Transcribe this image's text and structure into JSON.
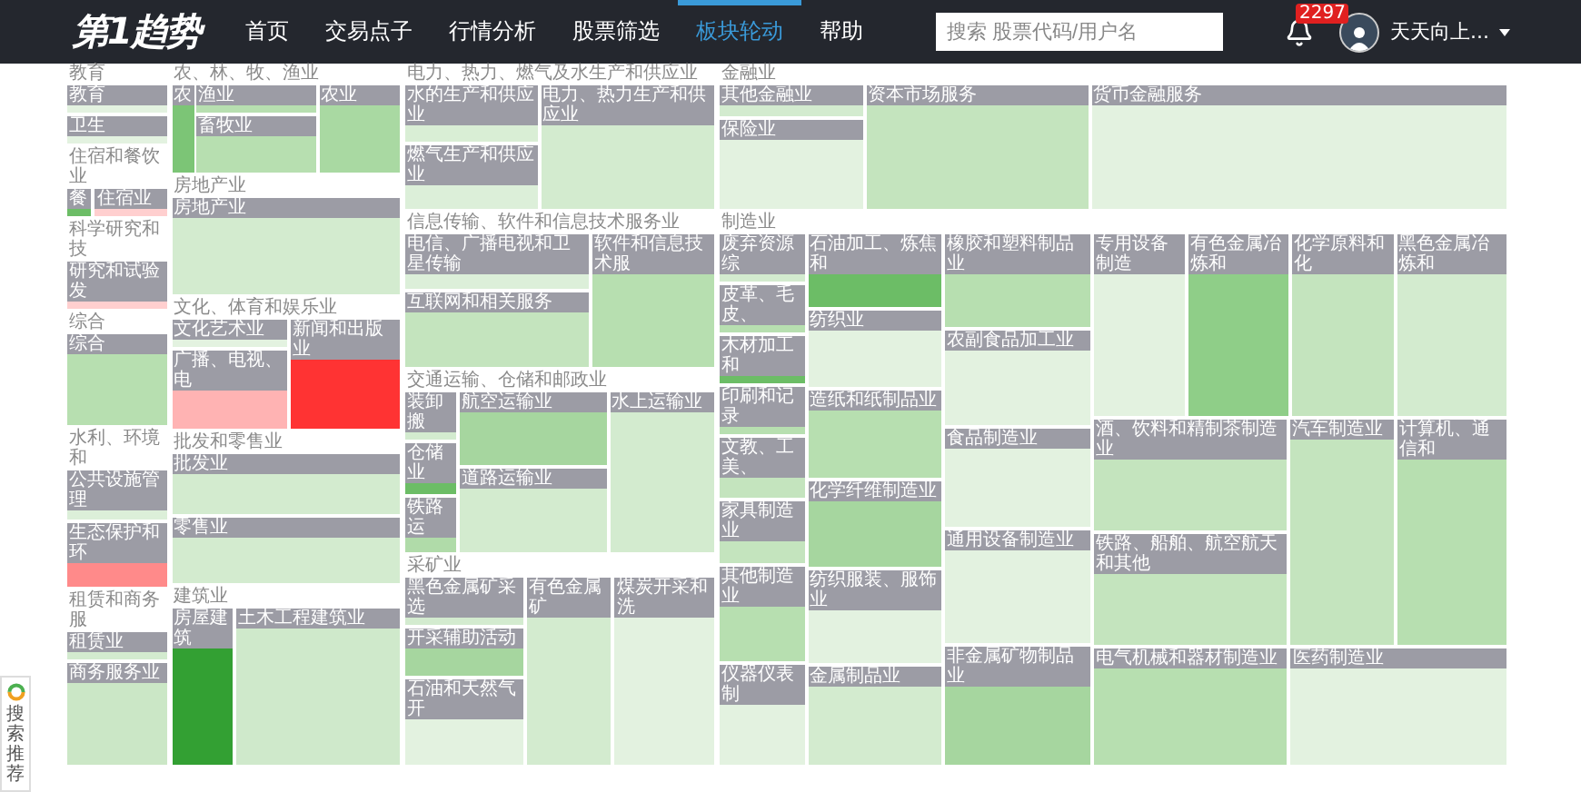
{
  "nav": {
    "logo": "第1趋势",
    "items": [
      {
        "label": "首页",
        "selected": false
      },
      {
        "label": "交易点子",
        "selected": false
      },
      {
        "label": "行情分析",
        "selected": false
      },
      {
        "label": "股票筛选",
        "selected": false
      },
      {
        "label": "板块轮动",
        "selected": true
      },
      {
        "label": "帮助",
        "selected": false
      }
    ],
    "search": {
      "placeholder": "搜索 股票代码/用户名"
    },
    "notifications": "2297",
    "user": "天天向上..."
  },
  "sectors": [
    {
      "title": "教育",
      "industries": [
        {
          "label": "教育",
          "color": "#e3f2e0"
        },
        {
          "label": "卫生",
          "color": "#e3f2e0"
        }
      ]
    },
    {
      "title": "住宿和餐饮业",
      "industries": [
        {
          "label": "餐",
          "color": "#6cbd66"
        },
        {
          "label": "住宿业",
          "color": "#ffcfcf"
        }
      ]
    },
    {
      "title": "科学研究和技",
      "industries": [
        {
          "label": "研究和试验发",
          "color": "#ffcfcf"
        }
      ]
    },
    {
      "title": "综合",
      "industries": [
        {
          "label": "综合",
          "color": "#b7dfb0"
        }
      ]
    },
    {
      "title": "水利、环境和",
      "industries": [
        {
          "label": "公共设施管理",
          "color": "#dcefd9"
        },
        {
          "label": "生态保护和环",
          "color": "#ff8a8a"
        }
      ]
    },
    {
      "title": "租赁和商务服",
      "industries": [
        {
          "label": "租赁业",
          "color": "#d3ebcf"
        },
        {
          "label": "商务服务业",
          "color": "#cbe7c6"
        }
      ]
    },
    {
      "title": "农、林、牧、渔业",
      "industries": [
        {
          "label": "农",
          "color": "#7cc576"
        },
        {
          "label": "渔业",
          "color": "#b7dfb0"
        },
        {
          "label": "畜牧业",
          "color": "#b7dfb0"
        },
        {
          "label": "农业",
          "color": "#a9d9a2"
        }
      ]
    },
    {
      "title": "房地产业",
      "industries": [
        {
          "label": "房地产业",
          "color": "#d3ebcf"
        }
      ]
    },
    {
      "title": "文化、体育和娱乐业",
      "industries": [
        {
          "label": "文化艺术业",
          "color": "#e3f2e0"
        },
        {
          "label": "广播、电视、电",
          "color": "#ffb3b3"
        },
        {
          "label": "新闻和出版业",
          "color": "#ff3333"
        }
      ]
    },
    {
      "title": "批发和零售业",
      "industries": [
        {
          "label": "批发业",
          "color": "#d3ebcf"
        },
        {
          "label": "零售业",
          "color": "#d3ebcf"
        }
      ]
    },
    {
      "title": "建筑业",
      "industries": [
        {
          "label": "房屋建筑",
          "color": "#33a033"
        },
        {
          "label": "土木工程建筑业",
          "color": "#cfe9cb"
        }
      ]
    },
    {
      "title": "电力、热力、燃气及水生产和供应业",
      "industries": [
        {
          "label": "水的生产和供应业",
          "color": "#d9eed5"
        },
        {
          "label": "电力、热力生产和供应业",
          "color": "#d3ebcf"
        },
        {
          "label": "燃气生产和供应业",
          "color": "#dcefd9"
        }
      ]
    },
    {
      "title": "信息传输、软件和信息技术服务业",
      "industries": [
        {
          "label": "电信、广播电视和卫星传输",
          "color": "#dcefd9"
        },
        {
          "label": "互联网和相关服务",
          "color": "#c4e4be"
        },
        {
          "label": "软件和信息技术服",
          "color": "#b7dfb0"
        }
      ]
    },
    {
      "title": "交通运输、仓储和邮政业",
      "industries": [
        {
          "label": "装卸搬",
          "color": "#d3ebcf"
        },
        {
          "label": "仓储业",
          "color": "#6cbd66"
        },
        {
          "label": "铁路运",
          "color": "#b0dba9"
        },
        {
          "label": "航空运输业",
          "color": "#a6d69f"
        },
        {
          "label": "道路运输业",
          "color": "#d3ebcf"
        },
        {
          "label": "水上运输业",
          "color": "#d3ebcf"
        }
      ]
    },
    {
      "title": "采矿业",
      "industries": [
        {
          "label": "黑色金属矿采选",
          "color": "#d3ebcf"
        },
        {
          "label": "开采辅助活动",
          "color": "#a6d69f"
        },
        {
          "label": "石油和天然气开",
          "color": "#e3f2e0"
        },
        {
          "label": "有色金属矿",
          "color": "#d3ebcf"
        },
        {
          "label": "煤炭开采和洗",
          "color": "#e3f2e0"
        }
      ]
    },
    {
      "title": "金融业",
      "industries": [
        {
          "label": "其他金融业",
          "color": "#d3ebcf"
        },
        {
          "label": "保险业",
          "color": "#e3f2e0"
        },
        {
          "label": "资本市场服务",
          "color": "#c4e4be"
        },
        {
          "label": "货币金融服务",
          "color": "#e3f2e0"
        }
      ]
    },
    {
      "title": "制造业",
      "industries": [
        {
          "label": "废弃资源综",
          "color": "#d3ebcf"
        },
        {
          "label": "皮革、毛皮、",
          "color": "#b7dfb0"
        },
        {
          "label": "木材加工和",
          "color": "#6cbd66"
        },
        {
          "label": "印刷和记录",
          "color": "#b7dfb0"
        },
        {
          "label": "文教、工美、",
          "color": "#c4e4be"
        },
        {
          "label": "家具制造业",
          "color": "#c4e4be"
        },
        {
          "label": "其他制造业",
          "color": "#b7dfb0"
        },
        {
          "label": "仪器仪表制",
          "color": "#e3f2e0"
        },
        {
          "label": "石油加工、炼焦和",
          "color": "#6cbd66"
        },
        {
          "label": "纺织业",
          "color": "#e3f2e0"
        },
        {
          "label": "造纸和纸制品业",
          "color": "#b7dfb0"
        },
        {
          "label": "化学纤维制造业",
          "color": "#a6d69f"
        },
        {
          "label": "纺织服装、服饰业",
          "color": "#e3f2e0"
        },
        {
          "label": "金属制品业",
          "color": "#d3ebcf"
        },
        {
          "label": "橡胶和塑料制品业",
          "color": "#b7dfb0"
        },
        {
          "label": "农副食品加工业",
          "color": "#e3f2e0"
        },
        {
          "label": "食品制造业",
          "color": "#e3f2e0"
        },
        {
          "label": "通用设备制造业",
          "color": "#e3f2e0"
        },
        {
          "label": "非金属矿物制品业",
          "color": "#a6d69f"
        },
        {
          "label": "专用设备制造",
          "color": "#e3f2e0"
        },
        {
          "label": "有色金属冶炼和",
          "color": "#8fce88"
        },
        {
          "label": "化学原料和化",
          "color": "#c4e4be"
        },
        {
          "label": "黑色金属冶炼和",
          "color": "#d3ebcf"
        },
        {
          "label": "酒、饮料和精制茶制造业",
          "color": "#c4e4be"
        },
        {
          "label": "铁路、船舶、航空航天和其他",
          "color": "#c4e4be"
        },
        {
          "label": "汽车制造业",
          "color": "#c4e4be"
        },
        {
          "label": "计算机、通信和",
          "color": "#b7dfb0"
        },
        {
          "label": "电气机械和器材制造业",
          "color": "#b7dfb0"
        },
        {
          "label": "医药制造业",
          "color": "#e3f2e0"
        }
      ]
    }
  ],
  "side_widget": {
    "label": "搜索推荐"
  }
}
